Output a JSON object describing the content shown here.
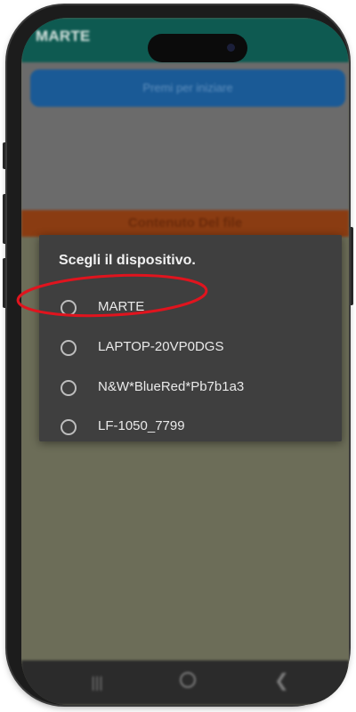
{
  "app": {
    "title": "MARTE",
    "start_button_label": "Premi per iniziare",
    "file_content_label": "Contenuto Del file"
  },
  "dialog": {
    "title": "Scegli il dispositivo.",
    "options": [
      {
        "label": "MARTE",
        "selected": false,
        "highlighted": true
      },
      {
        "label": "LAPTOP-20VP0DGS",
        "selected": false
      },
      {
        "label": "N&W*BlueRed*Pb7b1a3",
        "selected": false
      },
      {
        "label": "LF-1050_7799",
        "selected": false
      }
    ]
  },
  "navbar": {
    "icons": [
      "recents-icon",
      "home-icon",
      "back-icon"
    ]
  },
  "colors": {
    "appbar": "#0e5a51",
    "start_button": "#1a5a96",
    "file_bar": "#8a3c12",
    "dialog_bg": "#3f3f3f",
    "highlight": "#e0141e"
  }
}
